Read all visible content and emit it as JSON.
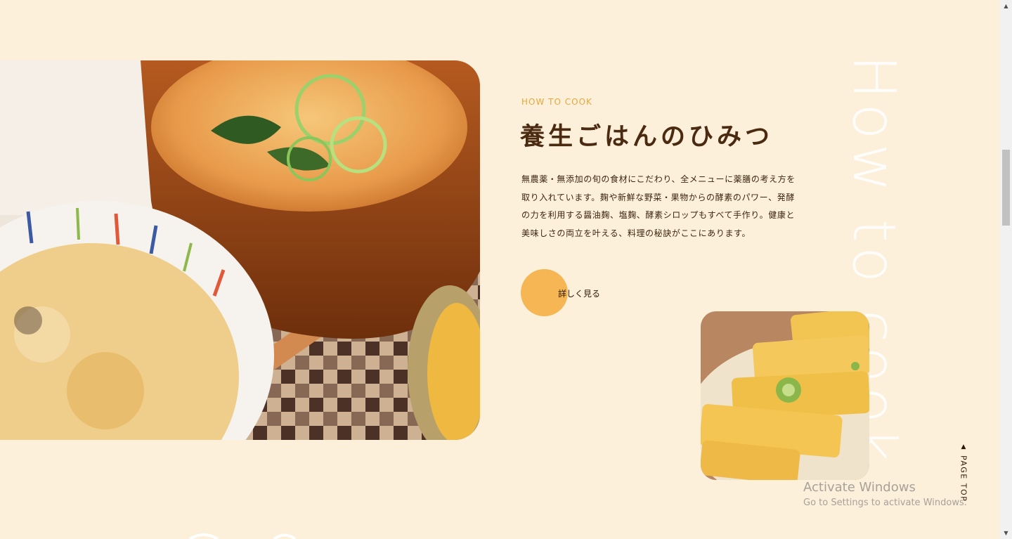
{
  "section": {
    "eyebrow": "HOW TO COOK",
    "title": "養生ごはんのひみつ",
    "body": "無農薬・無添加の旬の食材にこだわり、全メニューに薬膳の考え方を取り入れています。麹や新鮮な野菜・果物からの酵素のパワー、発酵の力を利用する醤油麹、塩麹、酵素シロップもすべて手作り。健康と美味しさの両立を叶える、料理の秘訣がここにあります。",
    "more_label": "詳しく見る",
    "deco_text": "How to cook"
  },
  "page_top": {
    "arrow": "▲",
    "label": "PAGE TOP"
  },
  "watermark": {
    "title": "Activate Windows",
    "subtitle": "Go to Settings to activate Windows."
  },
  "scrollbar": {
    "up_arrow": "▲",
    "down_arrow": "▼"
  },
  "colors": {
    "background": "#fdf0da",
    "accent": "#f5b653",
    "eyebrow": "#e8a73c",
    "title": "#4a2a10"
  }
}
